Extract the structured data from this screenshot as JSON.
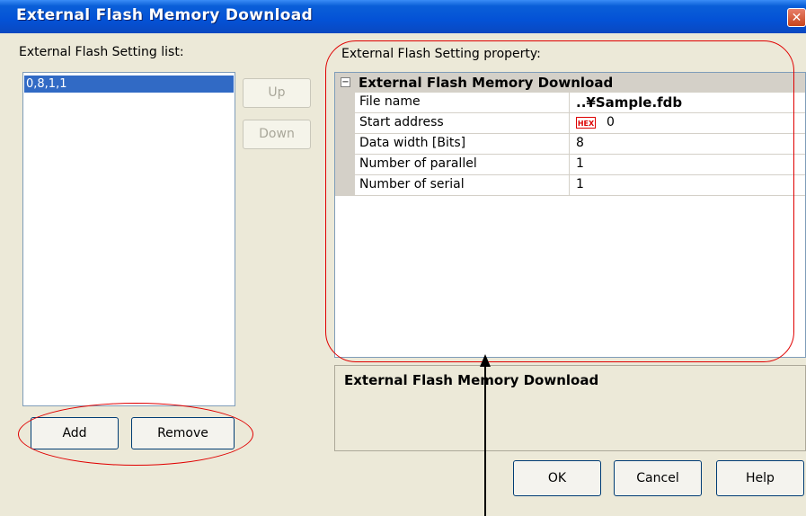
{
  "window": {
    "title": "External Flash Memory Download",
    "close_icon": "close-icon"
  },
  "left": {
    "list_label": "External Flash Setting list:",
    "items": [
      "0,8,1,1"
    ],
    "up_label": "Up",
    "down_label": "Down",
    "add_label": "Add",
    "remove_label": "Remove"
  },
  "right": {
    "property_label": "External Flash Setting property:",
    "category": "External Flash Memory Download",
    "properties": [
      {
        "name": "File name",
        "value": "..¥Sample.fdb"
      },
      {
        "name": "Start address",
        "value": "0",
        "badge": "HEX"
      },
      {
        "name": "Data width [Bits]",
        "value": "8"
      },
      {
        "name": "Number of parallel",
        "value": "1"
      },
      {
        "name": "Number of serial",
        "value": "1"
      }
    ],
    "description_title": "External Flash Memory Download"
  },
  "footer": {
    "ok_label": "OK",
    "cancel_label": "Cancel",
    "help_label": "Help"
  },
  "colors": {
    "selection": "#316ac5",
    "annotation": "#e00000",
    "titlebar": "#0452d6"
  }
}
